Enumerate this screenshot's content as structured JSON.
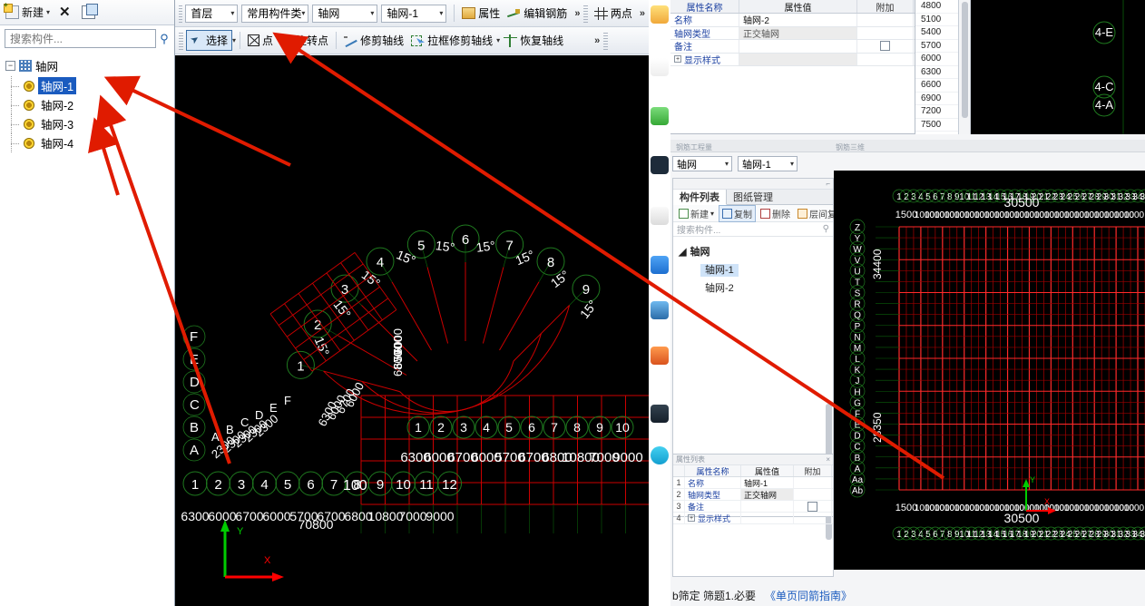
{
  "left_panel": {
    "toolbar": {
      "new_label": "新建",
      "new_icon": "new-document-icon",
      "delete_icon": "close-x-icon",
      "copy_icon": "copy-icon",
      "dropdown_caret": "▾"
    },
    "search": {
      "placeholder": "搜索构件...",
      "icon": "search-icon"
    },
    "tree": {
      "root_label": "轴网",
      "root_icon": "grid-icon",
      "expander": "−",
      "items": [
        {
          "label": "轴网-1",
          "selected": true
        },
        {
          "label": "轴网-2",
          "selected": false
        },
        {
          "label": "轴网-3",
          "selected": false
        },
        {
          "label": "轴网-4",
          "selected": false
        }
      ]
    }
  },
  "toolbar_row1": {
    "floor_select": "首层",
    "category_select": "常用构件类",
    "type_select": "轴网",
    "instance_select": "轴网-1",
    "properties_label": "属性",
    "edit_rebar_label": "编辑钢筋",
    "two_point_label": "两点",
    "overflow": "»"
  },
  "toolbar_row2": {
    "select_label": "选择",
    "point_label": "点",
    "rotate_point_label": "旋转点",
    "trim_axis_label": "修剪轴线",
    "frame_trim_axis_label": "拉框修剪轴线",
    "restore_axis_label": "恢复轴线",
    "overflow": "»",
    "caret": "▾"
  },
  "prop_top": {
    "headers": [
      "属性名称",
      "属性值",
      "附加"
    ],
    "rows": [
      {
        "name": "名称",
        "value": "轴网-2",
        "check": false,
        "grey": false
      },
      {
        "name": "轴网类型",
        "value": "正交轴网",
        "check": false,
        "grey": true
      },
      {
        "name": "备注",
        "value": "",
        "check": true,
        "grey": false
      },
      {
        "name": "显示样式",
        "value": "",
        "check": false,
        "grey": true,
        "expandable": true
      }
    ]
  },
  "number_column": {
    "values": [
      "4800",
      "5100",
      "5400",
      "5700",
      "6000",
      "6300",
      "6600",
      "6900",
      "7200",
      "7500"
    ]
  },
  "right_mid": {
    "strip_labels": [
      "钢筋工程量",
      "钢筋三维"
    ],
    "combo_type": "轴网",
    "combo_instance": "轴网-1",
    "component_panel": {
      "tabs": [
        {
          "label": "构件列表",
          "active": true
        },
        {
          "label": "图纸管理",
          "active": false
        }
      ],
      "tools": [
        {
          "label": "新建",
          "icon": "new-icon",
          "caret": "▾",
          "framed": false
        },
        {
          "label": "复制",
          "icon": "copy-icon",
          "framed": true
        },
        {
          "label": "删除",
          "icon": "delete-icon",
          "framed": false
        },
        {
          "label": "层间复制",
          "icon": "layer-copy-icon",
          "framed": false
        }
      ],
      "overflow": "»",
      "search_placeholder": "搜索构件...",
      "search_icon": "search-icon",
      "tree_root": "轴网",
      "tree_items": [
        {
          "label": "轴网-1",
          "selected": true
        },
        {
          "label": "轴网-2",
          "selected": false
        }
      ]
    },
    "prop_bottom": {
      "title": "属性列表",
      "close": "×",
      "headers": [
        "",
        "属性名称",
        "属性值",
        "附加"
      ],
      "rows": [
        {
          "idx": "1",
          "name": "名称",
          "value": "轴网-1",
          "check": false,
          "expandable": false
        },
        {
          "idx": "2",
          "name": "轴网类型",
          "value": "正交轴网",
          "check": false,
          "expandable": false,
          "grey": true
        },
        {
          "idx": "3",
          "name": "备注",
          "value": "",
          "check": true,
          "expandable": false
        },
        {
          "idx": "4",
          "name": "显示样式",
          "value": "",
          "check": false,
          "expandable": true
        }
      ]
    },
    "status_text": "b筛定   筛题1.必要",
    "status_link": "《单页同箭指南》"
  },
  "cad_main": {
    "bg": "#000000",
    "axis_color": "#ff0000",
    "label_color": "#1f7a1f",
    "text_color": "#ffffff",
    "radial_axis_labels": [
      "1",
      "2",
      "3",
      "4",
      "5",
      "6",
      "7",
      "8",
      "9"
    ],
    "angle_labels": [
      "15°",
      "15°",
      "15°",
      "15°",
      "15°",
      "15°",
      "15°",
      "15°",
      "15°"
    ],
    "bottom_axis_labels": [
      "1",
      "2",
      "3",
      "4",
      "5",
      "6",
      "7",
      "8",
      "9",
      "10",
      "11",
      "12"
    ],
    "grid_axis_labels": [
      "1",
      "2",
      "3",
      "4",
      "5",
      "6",
      "7",
      "8",
      "9",
      "10"
    ],
    "letter_labels": [
      "A",
      "B",
      "C",
      "D",
      "E",
      "F"
    ],
    "inner_letter_labels": [
      "A",
      "B",
      "C",
      "D",
      "E",
      "F"
    ],
    "dimension_strings": [
      "6300",
      "6000",
      "6700",
      "6000",
      "5700",
      "6700",
      "6800",
      "10800",
      "7000",
      "9000"
    ],
    "dimension_total": "70800",
    "dim_secondary": "100",
    "dim_rotated": "2300",
    "axis_gizmo": {
      "x_label": "X",
      "y_label": "Y",
      "x_color": "#ff0000",
      "y_color": "#00cc00"
    }
  },
  "cad_top_right": {
    "labels": [
      "4-E",
      "4-C",
      "4-A"
    ]
  },
  "cad_mid_right": {
    "top_axis_numbers": [
      "1",
      "2",
      "3",
      "4",
      "5",
      "6",
      "7",
      "8",
      "9",
      "10",
      "11",
      "12",
      "13",
      "14",
      "15",
      "16",
      "17",
      "18",
      "19",
      "20",
      "21",
      "22",
      "23",
      "24",
      "25",
      "26",
      "27",
      "28",
      "29",
      "30",
      "31",
      "32",
      "33",
      "34",
      "35"
    ],
    "total_dim_top": "30500",
    "total_dim_bottom": "30500",
    "side_dim_top": "34400",
    "side_dim_bottom": "28350",
    "left_axis_letters": [
      "Z",
      "Y",
      "W",
      "V",
      "U",
      "T",
      "S",
      "R",
      "Q",
      "P",
      "N",
      "M",
      "L",
      "K",
      "J",
      "H",
      "G",
      "F",
      "E",
      "D",
      "C",
      "B",
      "A",
      "Aa",
      "Ab"
    ],
    "grid_color": "#ff0000",
    "aux_color": "#00aa00",
    "axis_gizmo": {
      "x_label": "X",
      "y_label": "Y"
    }
  },
  "annotations": {
    "arrow_color": "#e01b00",
    "arrow_count": 4
  }
}
